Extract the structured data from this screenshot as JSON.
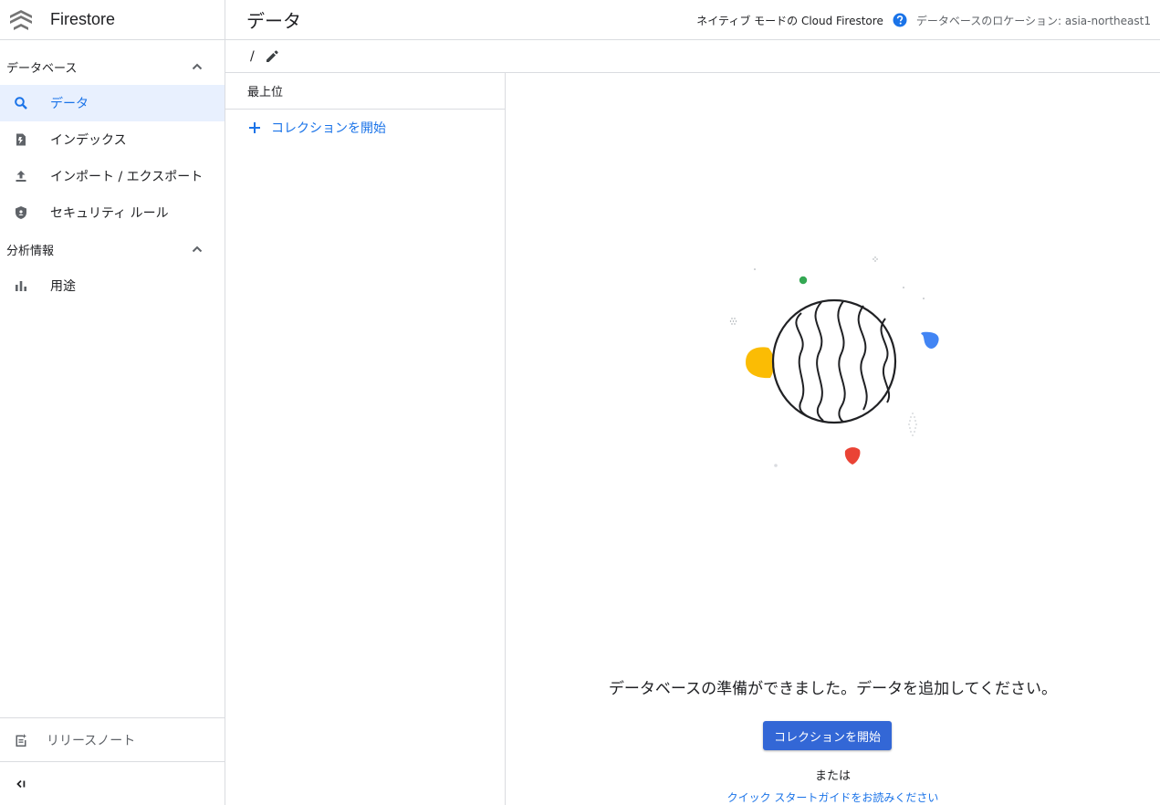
{
  "app": {
    "name": "Firestore"
  },
  "sidebar": {
    "sections": [
      {
        "title": "データベース",
        "items": [
          {
            "label": "データ",
            "icon": "search-icon",
            "active": true
          },
          {
            "label": "インデックス",
            "icon": "index-icon",
            "active": false
          },
          {
            "label": "インポート / エクスポート",
            "icon": "upload-icon",
            "active": false
          },
          {
            "label": "セキュリティ ルール",
            "icon": "shield-icon",
            "active": false
          }
        ]
      },
      {
        "title": "分析情報",
        "items": [
          {
            "label": "用途",
            "icon": "bar-chart-icon",
            "active": false
          }
        ]
      }
    ],
    "release_notes": "リリースノート",
    "collapse_icon": "collapse-icon"
  },
  "header": {
    "title": "データ",
    "mode": "ネイティブ モードの Cloud Firestore",
    "location": "データベースのロケーション: asia-northeast1"
  },
  "pathbar": {
    "path": "/"
  },
  "column": {
    "header": "最上位",
    "start_collection": "コレクションを開始"
  },
  "main": {
    "ready_message": "データベースの準備ができました。データを追加してください。",
    "start_button": "コレクションを開始",
    "or": "または",
    "guide_link": "クイック スタートガイドをお読みください"
  },
  "colors": {
    "accent": "#1a73e8",
    "button": "#3367d6",
    "active_bg": "#e8f0fe",
    "yellow": "#fbbc04",
    "blue": "#4285f4",
    "red": "#ea4335",
    "green": "#34a853"
  }
}
